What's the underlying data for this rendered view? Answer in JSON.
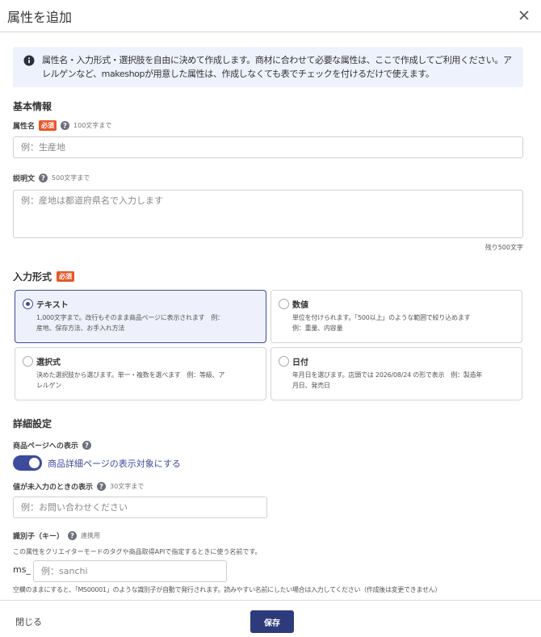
{
  "modal": {
    "title": "属性を追加"
  },
  "notice": {
    "line1": "属性名・入力形式・選択肢を自由に決めて作成します。商材に合わせて必要な属性は、ここで作成してご利用ください。ア",
    "line2": "レルゲンなど、makeshopが用意した属性は、作成しなくても表でチェックを付けるだけで使えます。"
  },
  "basic": {
    "section_title": "基本情報",
    "name_label": "属性名",
    "required_badge": "必須",
    "name_limit": "100文字まで",
    "name_placeholder": "例：生産地",
    "name_value": "",
    "desc_label": "説明文",
    "desc_limit": "500文字まで",
    "desc_placeholder": "例：産地は都道府県名で入力します",
    "desc_value": "",
    "desc_counter": "残り500文字"
  },
  "input_format": {
    "section_title": "入力形式",
    "required_badge": "必須",
    "selected": "text",
    "options": [
      {
        "title": "テキスト",
        "desc_line1": "1,000文字まで。改行もそのまま商品ページに表示されます　例：",
        "desc_line2": "産地、保存方法、お手入れ方法"
      },
      {
        "title": "数値",
        "desc_line1": "単位を付けられます。「500以上」のような範囲で絞り込めます",
        "desc_line2": "例：重量、内容量"
      },
      {
        "title": "選択式",
        "desc_line1": "決めた選択肢から選びます。単一・複数を選べます　例：等級、ア",
        "desc_line2": "レルゲン"
      },
      {
        "title": "日付",
        "desc_line1": "年月日を選びます。店頭では 2026/08/24 の形で表示　例：製造年",
        "desc_line2": "月日、発売日"
      }
    ]
  },
  "detail": {
    "section_title": "詳細設定",
    "display_label": "商品ページへの表示",
    "toggle_on": true,
    "toggle_label": "商品詳細ページの表示対象にする",
    "empty_label": "値が未入力のときの表示",
    "empty_limit": "30文字まで",
    "empty_placeholder": "例：お問い合わせください",
    "key_label": "識別子（キー）",
    "key_note": "連携用",
    "key_help": "この属性をクリエイターモードのタグや商品取得APIで指定するときに使う名前です。",
    "key_prefix": "ms_",
    "key_placeholder": "例：sanchi",
    "key_footnote": "空欄のままにすると、「MS00001」のような識別子が自動で発行されます。読みやすい名前にしたい場合は入力してください（作成後は変更できません）"
  },
  "footer": {
    "close_label": "閉じる",
    "save_label": "保存"
  },
  "colors": {
    "accent": "#3d4b9c",
    "save_button": "#2e3b7a",
    "required_badge": "#e6582b",
    "notice_bg": "#eef2fc"
  },
  "icons": {
    "close": "close-icon",
    "info": "info-icon",
    "help": "help-icon"
  }
}
